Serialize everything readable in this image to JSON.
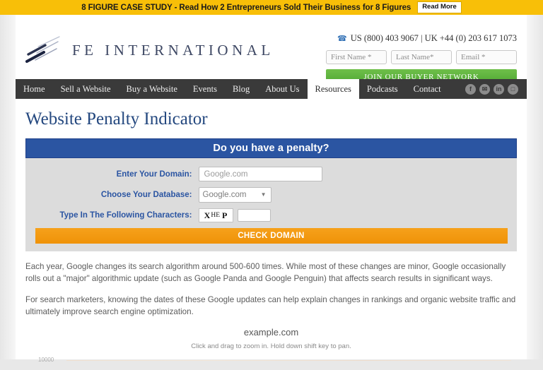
{
  "promo": {
    "text": "8 FIGURE CASE STUDY - Read How 2 Entrepreneurs Sold Their Business for 8 Figures",
    "button_label": "Read More",
    "bg_color": "#f8bf08"
  },
  "header": {
    "logo_text": "FE INTERNATIONAL",
    "logo_icon": "diagonal-slashes-logo",
    "phone_icon": "phone-icon",
    "phone": "US (800) 403 9067 | UK +44 (0) 203 617 1073",
    "optin": {
      "first_name_placeholder": "First Name *",
      "first_name_value": "",
      "last_name_placeholder": "Last Name*",
      "last_name_value": "",
      "email_placeholder": "Email *",
      "email_value": "",
      "submit_label": "JOIN OUR BUYER NETWORK",
      "submit_color": "#5cb23c"
    }
  },
  "nav": {
    "items": [
      {
        "label": "Home",
        "active": false
      },
      {
        "label": "Sell a Website",
        "active": false
      },
      {
        "label": "Buy a Website",
        "active": false
      },
      {
        "label": "Events",
        "active": false
      },
      {
        "label": "Blog",
        "active": false
      },
      {
        "label": "About Us",
        "active": false
      },
      {
        "label": "Resources",
        "active": true
      },
      {
        "label": "Podcasts",
        "active": false
      },
      {
        "label": "Contact",
        "active": false
      }
    ],
    "social": [
      {
        "name": "facebook-icon",
        "glyph": "f"
      },
      {
        "name": "twitter-icon",
        "glyph": "✉"
      },
      {
        "name": "linkedin-icon",
        "glyph": "in"
      },
      {
        "name": "instagram-icon",
        "glyph": "□"
      }
    ]
  },
  "page": {
    "title": "Website Penalty Indicator",
    "title_color": "#24487f"
  },
  "widget": {
    "heading": "Do you have a penalty?",
    "heading_bg": "#2b55a2",
    "domain_label": "Enter Your Domain:",
    "domain_placeholder": "Google.com",
    "domain_value": "",
    "database_label": "Choose Your Database:",
    "database_selected": "Google.com",
    "database_options": [
      "Google.com"
    ],
    "captcha_label": "Type In The Following Characters:",
    "captcha_chars": {
      "part1": "X",
      "part2": "HE",
      "part3": "P"
    },
    "captcha_value": "",
    "submit_label": "CHECK DOMAIN",
    "submit_color": "#f19a10"
  },
  "copy": {
    "p1": "Each year, Google changes its search algorithm around 500-600 times. While most of these changes are minor, Google occasionally rolls out a \"major\" algorithmic update (such as Google Panda and Google Penguin) that affects search results in significant ways.",
    "p2": "For search marketers, knowing the dates of these Google updates can help explain changes in rankings and organic website traffic and ultimately improve search engine optimization."
  },
  "chart_data": {
    "type": "line",
    "title": "example.com",
    "subtitle": "Click and drag to zoom in. Hold down shift key to pan.",
    "xlabel": "",
    "ylabel": "",
    "y_ticks": [
      "10000"
    ],
    "x_ticks": [],
    "series": [],
    "grid": true,
    "legend": "none"
  }
}
